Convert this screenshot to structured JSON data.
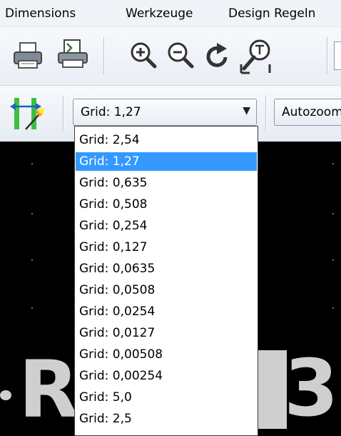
{
  "menubar": {
    "items": [
      "Dimensions",
      "Werkzeuge",
      "Design Regeln"
    ]
  },
  "toolbar": {
    "icons": [
      "print-icon",
      "plot-icon",
      "zoom-in-icon",
      "zoom-out-icon",
      "redraw-icon",
      "zoom-fit-icon"
    ]
  },
  "grid_select": {
    "selected": "Grid: 1,27",
    "arrow": "▼",
    "options": [
      "Grid: 2,54",
      "Grid: 1,27",
      "Grid: 0,635",
      "Grid: 0,508",
      "Grid: 0,254",
      "Grid: 0,127",
      "Grid: 0,0635",
      "Grid: 0,0508",
      "Grid: 0,0254",
      "Grid: 0,0127",
      "Grid: 0,00508",
      "Grid: 0,00254",
      "Grid: 5,0",
      "Grid: 2,5"
    ],
    "highlighted_index": 1
  },
  "zoom_select": {
    "value": "Autozoom"
  },
  "canvas": {
    "visible_text": [
      "R",
      "3"
    ],
    "colors": {
      "background": "#000000",
      "text": "#cfcfcf"
    }
  },
  "colors": {
    "highlight": "#3399ff",
    "menubar": "#f0f4f9"
  }
}
